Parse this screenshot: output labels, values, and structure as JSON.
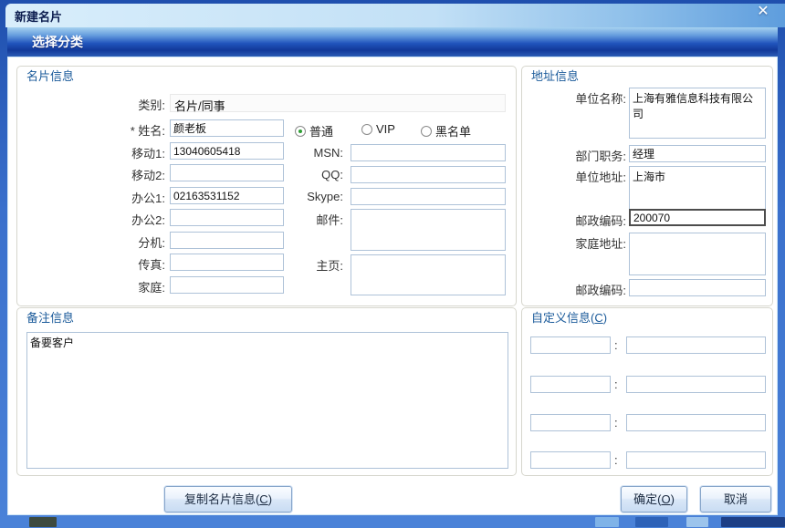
{
  "window": {
    "title": "新建名片",
    "close_glyph": "✕"
  },
  "header": {
    "subtitle": "选择分类"
  },
  "card_info": {
    "legend": "名片信息",
    "category": {
      "label": "类别:",
      "value": "名片/同事"
    },
    "name": {
      "required": "*",
      "label": "姓名:",
      "value": "颜老板"
    },
    "radios": [
      {
        "label": "普通",
        "selected": true
      },
      {
        "label": "VIP",
        "selected": false
      },
      {
        "label": "黑名单",
        "selected": false
      }
    ],
    "left_fields": [
      {
        "label": "移动1:",
        "value": "13040605418"
      },
      {
        "label": "移动2:",
        "value": ""
      },
      {
        "label": "办公1:",
        "value": "02163531152"
      },
      {
        "label": "办公2:",
        "value": ""
      },
      {
        "label": "分机:",
        "value": ""
      },
      {
        "label": "传真:",
        "value": ""
      },
      {
        "label": "家庭:",
        "value": ""
      }
    ],
    "mid_fields": [
      {
        "label": "MSN:",
        "value": ""
      },
      {
        "label": "QQ:",
        "value": ""
      },
      {
        "label": "Skype:",
        "value": ""
      }
    ],
    "mid_areas": [
      {
        "label": "邮件:",
        "value": ""
      },
      {
        "label": "主页:",
        "value": ""
      }
    ]
  },
  "address_info": {
    "legend": "地址信息",
    "fields": [
      {
        "label": "单位名称:",
        "value": "上海有雅信息科技有限公司"
      },
      {
        "label": "部门职务:",
        "value": "经理"
      },
      {
        "label": "单位地址:",
        "value": "上海市"
      },
      {
        "label": "邮政编码:",
        "value": "200070"
      },
      {
        "label": "家庭地址:",
        "value": ""
      },
      {
        "label": "邮政编码:",
        "value": ""
      }
    ]
  },
  "notes": {
    "legend": "备注信息",
    "value": "备要客户"
  },
  "custom_info": {
    "legend_pre": "自定义信息(",
    "legend_key": "C",
    "legend_post": ")",
    "separator": ":"
  },
  "buttons": {
    "copy_pre": "复制名片信息(",
    "copy_key": "C",
    "copy_post": ")",
    "ok_pre": "确定(",
    "ok_key": "O",
    "ok_post": ")",
    "cancel": "取消"
  },
  "colors": {
    "header_band_dark": "#12399a",
    "titlebar_light": "#d9eefb",
    "legend_text": "#1a5a9a",
    "radio_selected_dot": "#2e9e33",
    "focused_field_border": "#4d4d4d",
    "frame_blue": "#3a70cc"
  }
}
